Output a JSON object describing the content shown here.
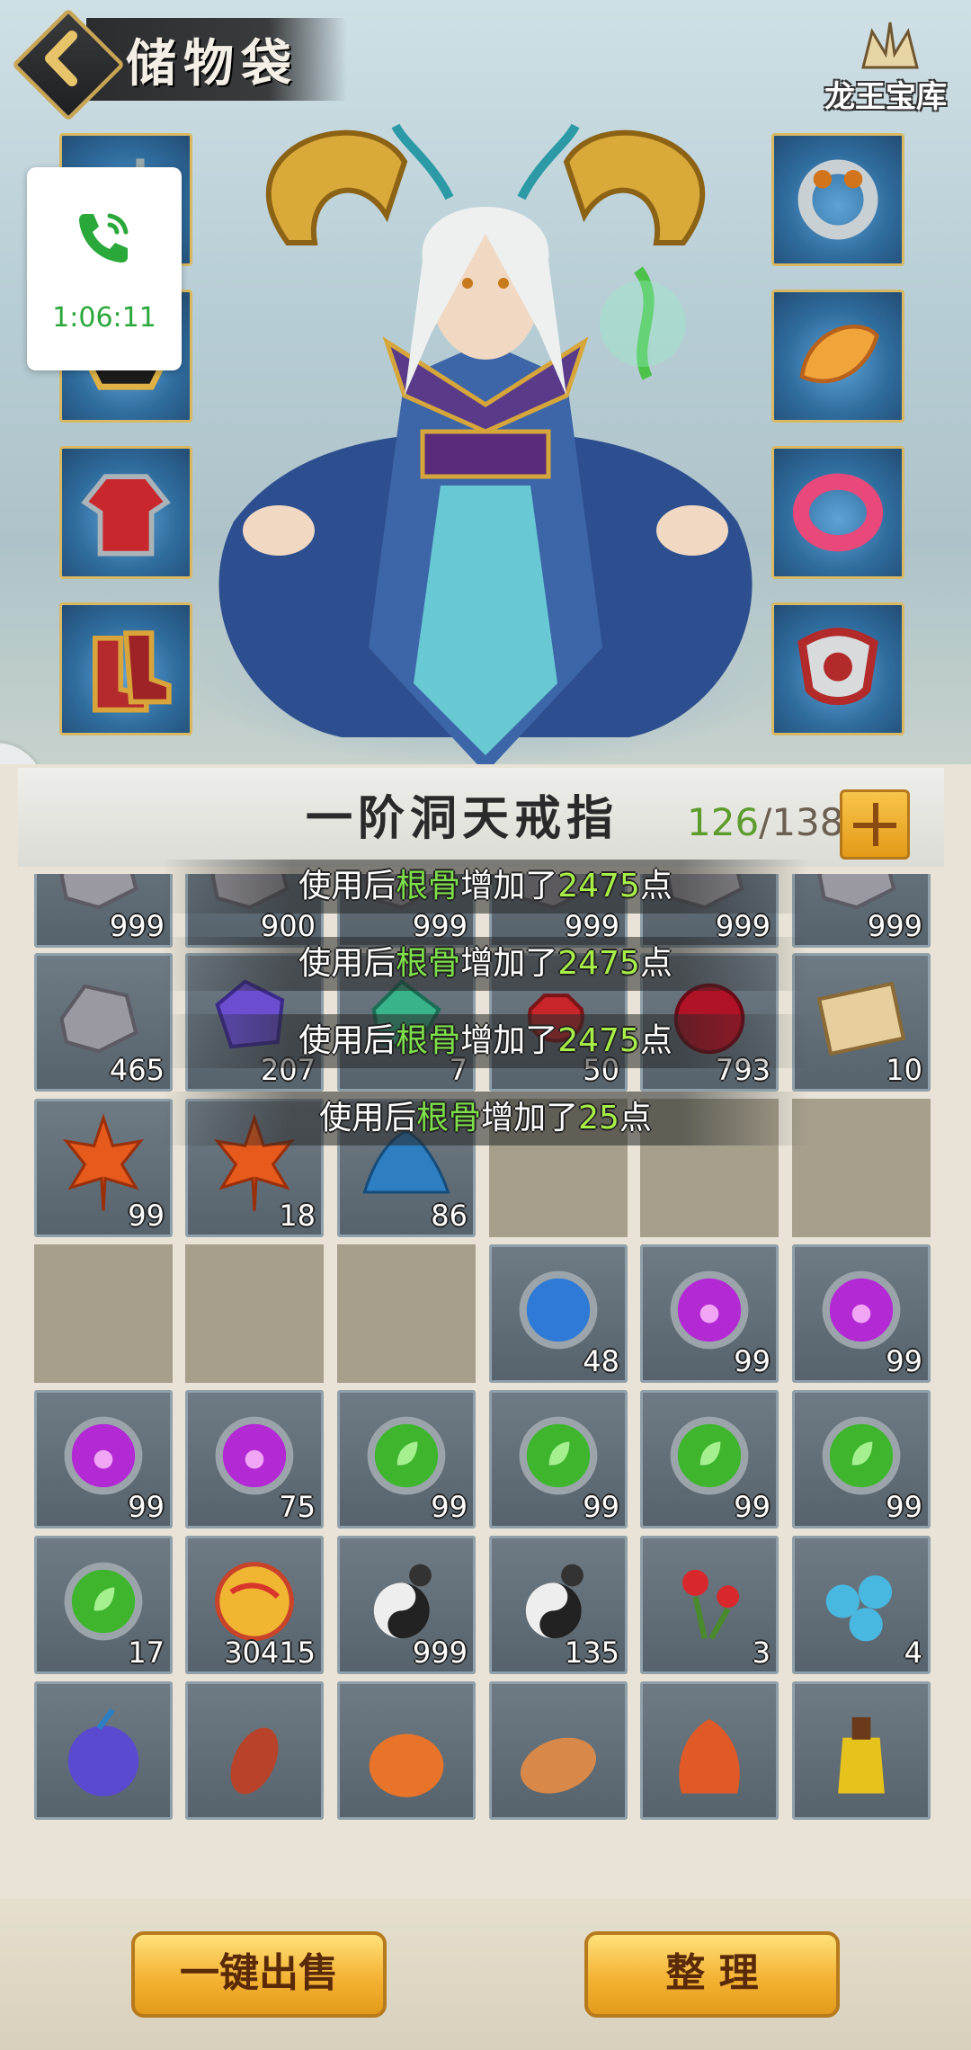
{
  "header": {
    "title": "储物袋",
    "treasure_label": "龙王宝库"
  },
  "call_widget": {
    "time": "1:06:11",
    "icon": "phone-icon",
    "color": "#2aa83a"
  },
  "bag": {
    "title": "一阶洞天戒指",
    "capacity_used": "126",
    "capacity_total": "/138"
  },
  "toasts": [
    {
      "prefix": "使用后",
      "attr": "根骨",
      "mid": "增加了",
      "value": "2475",
      "suffix": "点"
    },
    {
      "prefix": "使用后",
      "attr": "根骨",
      "mid": "增加了",
      "value": "2475",
      "suffix": "点"
    },
    {
      "prefix": "使用后",
      "attr": "根骨",
      "mid": "增加了",
      "value": "2475",
      "suffix": "点"
    },
    {
      "prefix": "使用后",
      "attr": "根骨",
      "mid": "增加了",
      "value": "25",
      "suffix": "点"
    }
  ],
  "rows": [
    [
      {
        "item": "gray-ore",
        "count": "999"
      },
      {
        "item": "gray-ore",
        "count": "900"
      },
      {
        "item": "gray-ore",
        "count": "999"
      },
      {
        "item": "gray-ore",
        "count": "999"
      },
      {
        "item": "gray-ore",
        "count": "999"
      },
      {
        "item": "gray-ore",
        "count": "999"
      }
    ],
    [
      {
        "item": "gray-ore",
        "count": "465"
      },
      {
        "item": "purple-gem",
        "count": "207"
      },
      {
        "item": "green-gem",
        "count": "7"
      },
      {
        "item": "red-pouch",
        "count": "50"
      },
      {
        "item": "red-fruit",
        "count": "793"
      },
      {
        "item": "scroll",
        "count": "10"
      }
    ],
    [
      {
        "item": "maple-leaf",
        "count": "99"
      },
      {
        "item": "maple-leaf",
        "count": "18"
      },
      {
        "item": "blue-powder",
        "count": "86"
      },
      null,
      null,
      null
    ],
    [
      null,
      null,
      null,
      {
        "item": "blue-orb",
        "count": "48"
      },
      {
        "item": "purple-orb",
        "count": "99"
      },
      {
        "item": "purple-orb",
        "count": "99"
      }
    ],
    [
      {
        "item": "purple-orb",
        "count": "99"
      },
      {
        "item": "purple-orb",
        "count": "75"
      },
      {
        "item": "green-orb",
        "count": "99"
      },
      {
        "item": "green-orb",
        "count": "99"
      },
      {
        "item": "green-orb",
        "count": "99"
      },
      {
        "item": "green-orb",
        "count": "99"
      }
    ],
    [
      {
        "item": "green-orb",
        "count": "17"
      },
      {
        "item": "golden-ball",
        "count": "30415"
      },
      {
        "item": "yinyang-gourd",
        "count": "999"
      },
      {
        "item": "yinyang-gourd",
        "count": "135"
      },
      {
        "item": "red-flower",
        "count": "3"
      },
      {
        "item": "blue-berries",
        "count": "4"
      }
    ],
    [
      {
        "item": "purple-fruit",
        "count": ""
      },
      {
        "item": "drumstick",
        "count": ""
      },
      {
        "item": "orange-lantern",
        "count": ""
      },
      {
        "item": "sweet-potato",
        "count": ""
      },
      {
        "item": "orange-bulb",
        "count": ""
      },
      {
        "item": "yellow-fruit",
        "count": ""
      }
    ]
  ],
  "equipment_left": [
    "helmet-icon",
    "armor-helm-icon",
    "robe-icon",
    "boots-icon"
  ],
  "equipment_right": [
    "ring-icon",
    "amulet-icon",
    "bracelet-icon",
    "shield-icon"
  ],
  "buttons": {
    "sell_all": "一键出售",
    "organize": "整 理"
  }
}
